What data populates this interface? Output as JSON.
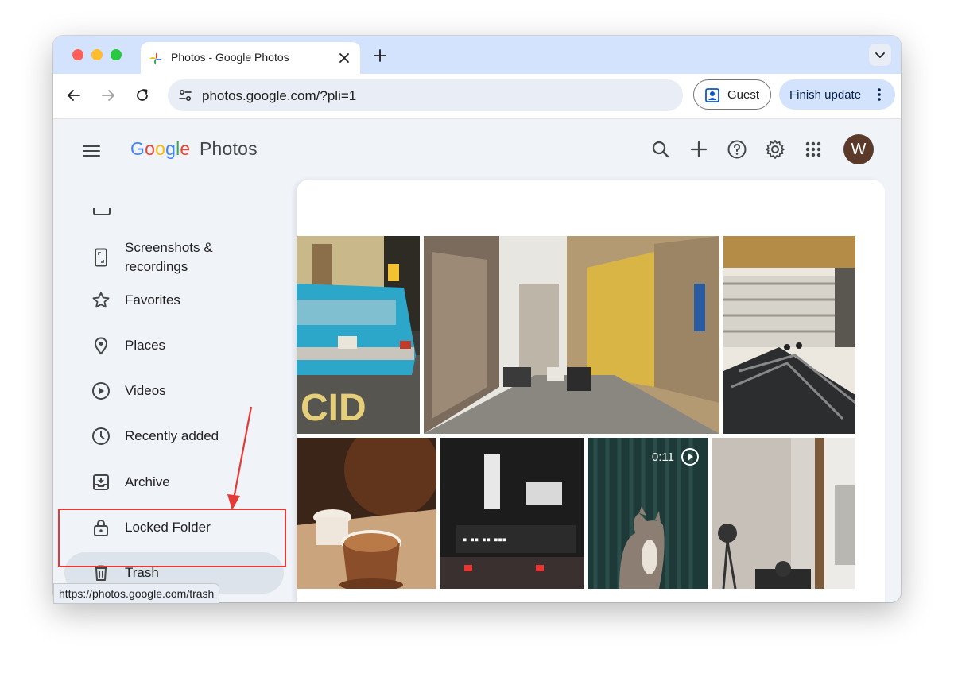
{
  "browser": {
    "tab_title": "Photos - Google Photos",
    "url": "photos.google.com/?pli=1",
    "guest_label": "Guest",
    "update_label": "Finish update",
    "status_url": "https://photos.google.com/trash"
  },
  "app": {
    "logo_google": [
      "G",
      "o",
      "o",
      "g",
      "l",
      "e"
    ],
    "logo_google_colors": [
      "#4285F4",
      "#EA4335",
      "#FBBC05",
      "#4285F4",
      "#34A853",
      "#EA4335"
    ],
    "logo_product": "Photos",
    "avatar_initial": "W",
    "header_icons": [
      "search-icon",
      "add-icon",
      "help-icon",
      "settings-icon",
      "apps-icon"
    ]
  },
  "sidebar": {
    "items": [
      {
        "label": "Screenshots & recordings",
        "icon": "phone-icon"
      },
      {
        "label": "Favorites",
        "icon": "star-icon"
      },
      {
        "label": "Places",
        "icon": "location-icon"
      },
      {
        "label": "Videos",
        "icon": "play-circle-icon"
      },
      {
        "label": "Recently added",
        "icon": "clock-icon"
      },
      {
        "label": "Archive",
        "icon": "archive-icon"
      },
      {
        "label": "Locked Folder",
        "icon": "lock-icon"
      },
      {
        "label": "Trash",
        "icon": "trash-icon",
        "active": true
      }
    ]
  },
  "photos": [
    {
      "name": "photo-blue-car",
      "description": "street"
    },
    {
      "name": "photo-street",
      "description": "street"
    },
    {
      "name": "photo-escalator",
      "description": "building"
    },
    {
      "name": "photo-coffee",
      "description": "coffee"
    },
    {
      "name": "photo-neon-signs",
      "description": "night"
    },
    {
      "name": "photo-cat-video",
      "description": "cat",
      "video_duration": "0:11"
    },
    {
      "name": "photo-room",
      "description": "room"
    }
  ],
  "colors": {
    "annotation": "#e53935",
    "accent_blue": "#d3e3fd",
    "active_item": "#dde3ea"
  }
}
